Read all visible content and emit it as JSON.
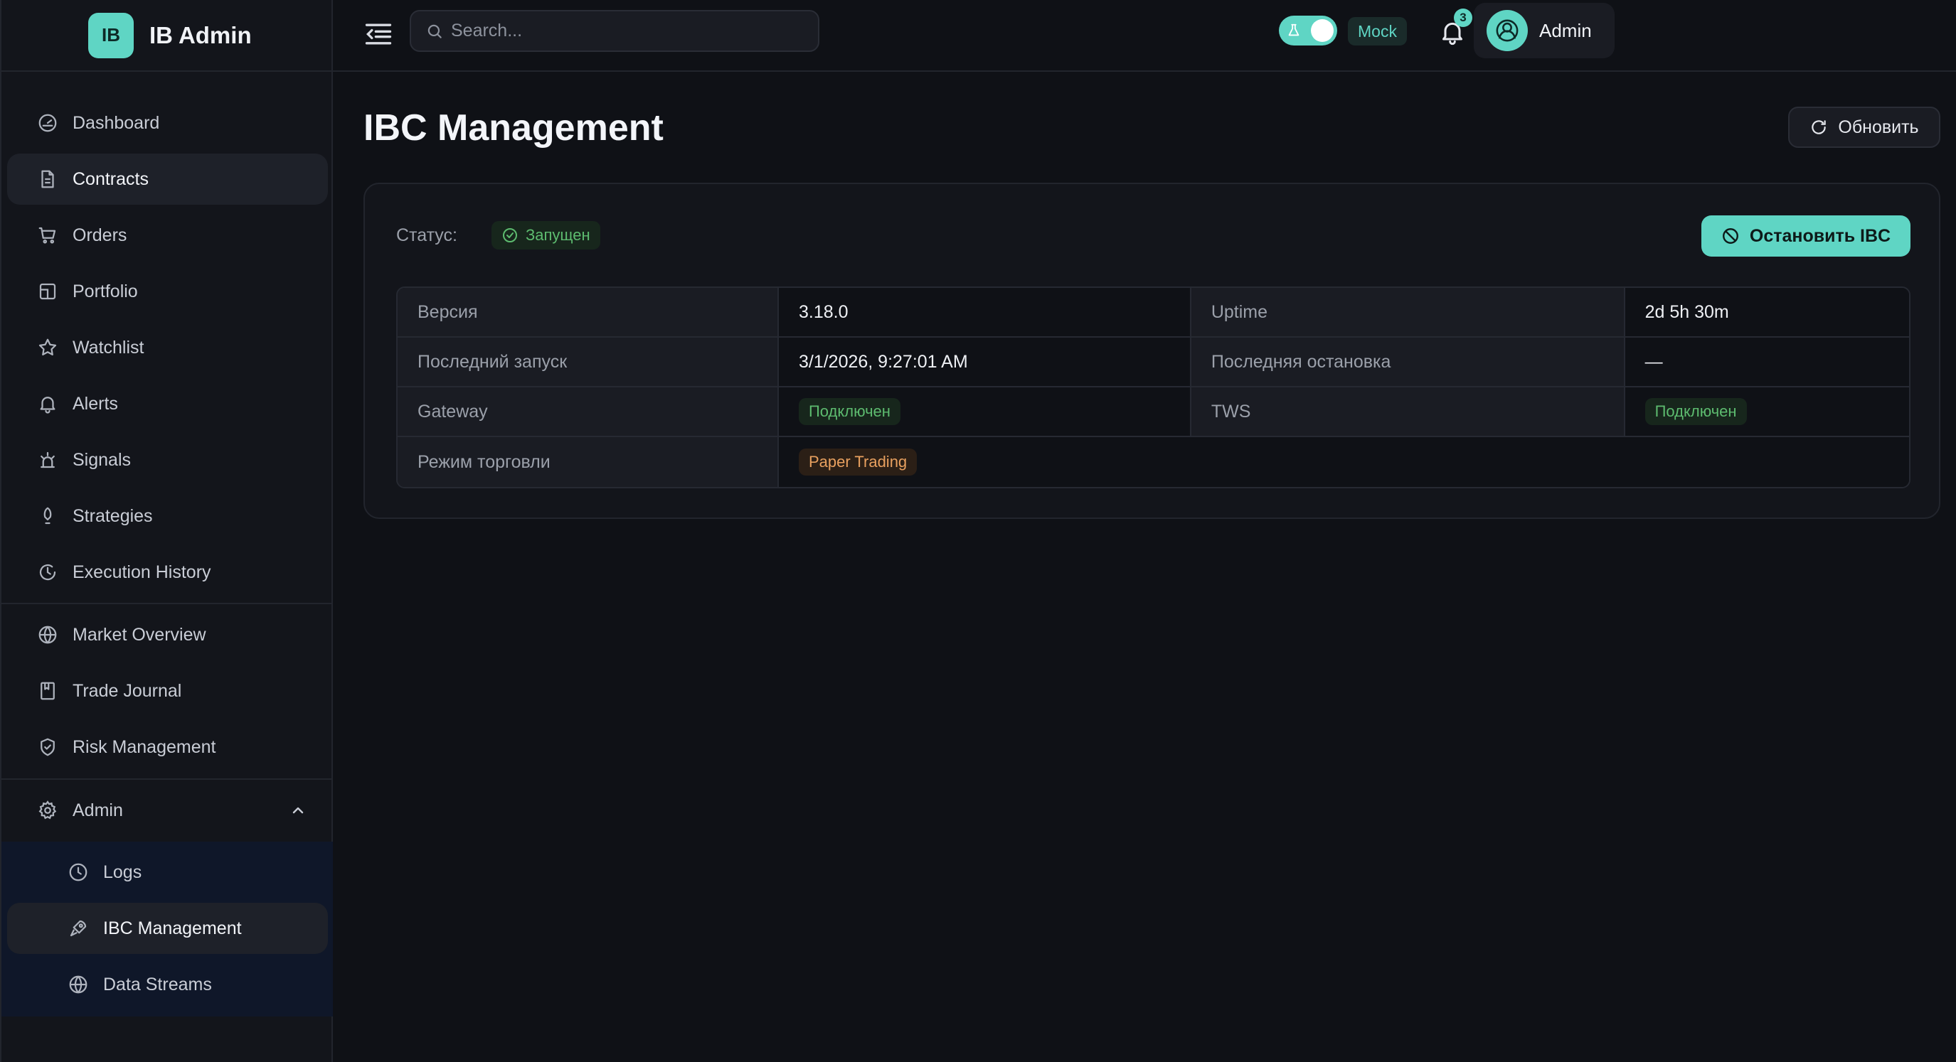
{
  "brand": {
    "logo": "IB",
    "name": "IB Admin"
  },
  "search": {
    "placeholder": "Search..."
  },
  "header": {
    "mode_label": "Mock",
    "notification_count": "3",
    "user_name": "Admin"
  },
  "sidebar": {
    "items": [
      {
        "label": "Dashboard",
        "icon": "gauge-icon"
      },
      {
        "label": "Contracts",
        "icon": "document-icon",
        "active": true
      },
      {
        "label": "Orders",
        "icon": "cart-icon"
      },
      {
        "label": "Portfolio",
        "icon": "portfolio-icon"
      },
      {
        "label": "Watchlist",
        "icon": "star-icon"
      },
      {
        "label": "Alerts",
        "icon": "bell-icon"
      },
      {
        "label": "Signals",
        "icon": "signal-icon"
      },
      {
        "label": "Strategies",
        "icon": "strategy-icon"
      },
      {
        "label": "Execution History",
        "icon": "history-icon"
      },
      {
        "label": "Market Overview",
        "icon": "globe-icon"
      },
      {
        "label": "Trade Journal",
        "icon": "bookmark-icon"
      },
      {
        "label": "Risk Management",
        "icon": "shield-icon"
      },
      {
        "label": "Admin",
        "icon": "gear-icon",
        "expanded": true
      }
    ],
    "admin_items": [
      {
        "label": "Logs",
        "icon": "clock-icon"
      },
      {
        "label": "IBC Management",
        "icon": "rocket-icon",
        "active": true
      },
      {
        "label": "Data Streams",
        "icon": "globe-icon"
      }
    ]
  },
  "page": {
    "title": "IBC Management",
    "refresh_label": "Обновить"
  },
  "status": {
    "label": "Статус:",
    "value": "Запущен",
    "stop_label": "Остановить IBC"
  },
  "info": {
    "version_label": "Версия",
    "version": "3.18.0",
    "uptime_label": "Uptime",
    "uptime": "2d 5h 30m",
    "last_start_label": "Последний запуск",
    "last_start": "3/1/2026, 9:27:01 AM",
    "last_stop_label": "Последняя остановка",
    "last_stop": "—",
    "gateway_label": "Gateway",
    "gateway": "Подключен",
    "tws_label": "TWS",
    "tws": "Подключен",
    "mode_label": "Режим торговли",
    "mode": "Paper Trading"
  },
  "colors": {
    "accent": "#5fd5c4",
    "success": "#5dbb6f",
    "warning": "#e8a05f",
    "background": "#0f1116"
  }
}
